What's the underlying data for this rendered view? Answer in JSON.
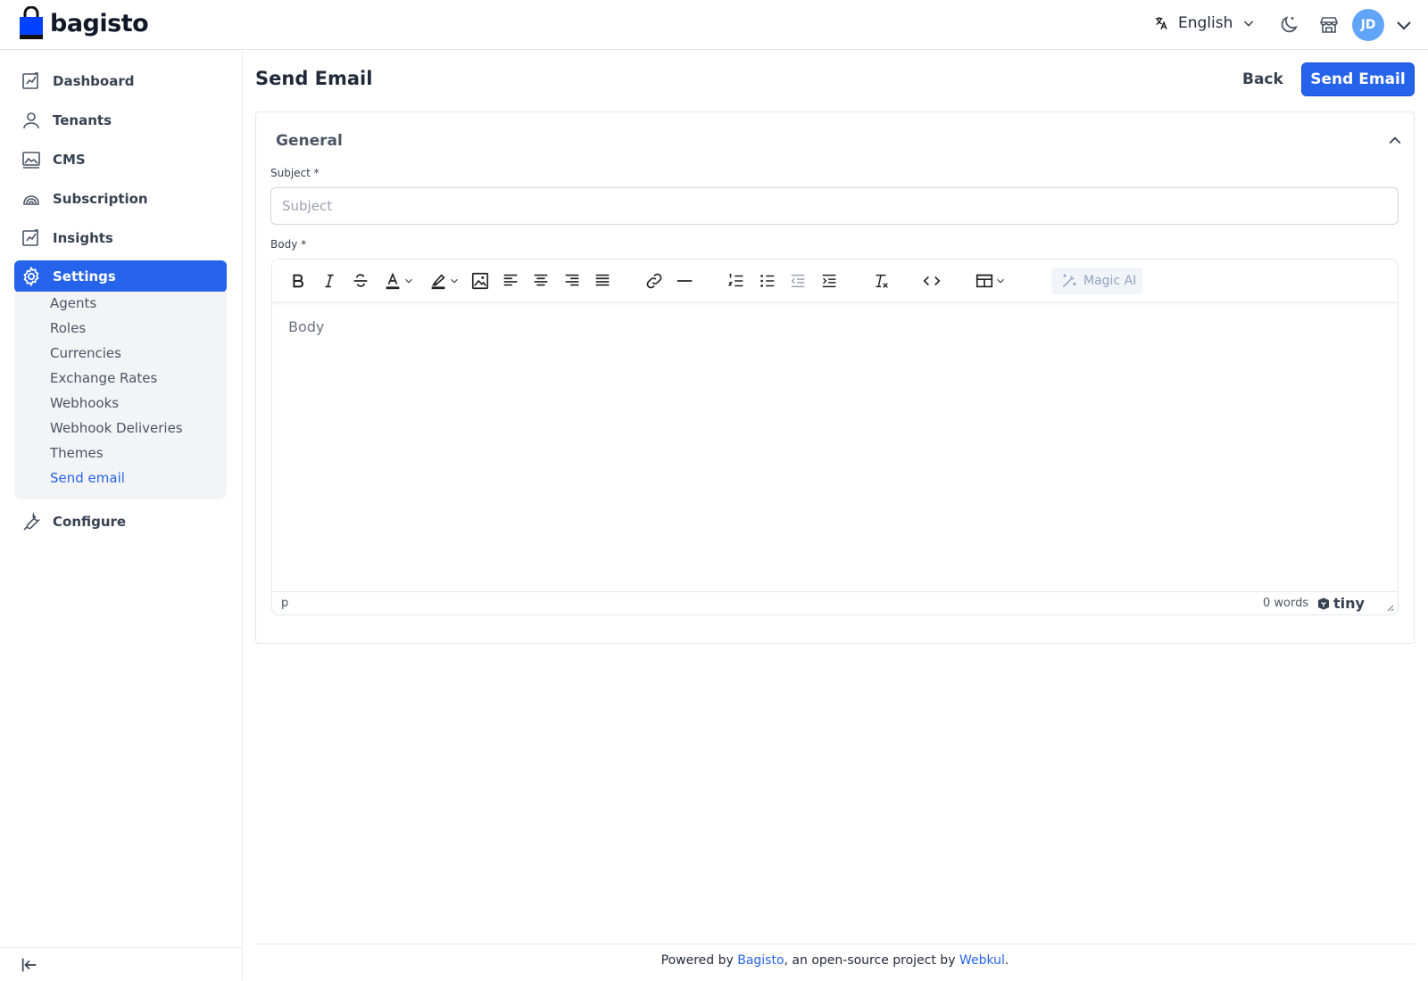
{
  "brand": {
    "name": "bagisto",
    "accent": "#2563eb"
  },
  "header": {
    "language": "English",
    "avatar_initials": "JD"
  },
  "sidebar": {
    "items": [
      {
        "label": "Dashboard"
      },
      {
        "label": "Tenants"
      },
      {
        "label": "CMS"
      },
      {
        "label": "Subscription"
      },
      {
        "label": "Insights"
      },
      {
        "label": "Settings"
      },
      {
        "label": "Configure"
      }
    ],
    "settings_sub": [
      "Agents",
      "Roles",
      "Currencies",
      "Exchange Rates",
      "Webhooks",
      "Webhook Deliveries",
      "Themes",
      "Send email"
    ]
  },
  "page": {
    "title": "Send Email",
    "back_label": "Back",
    "submit_label": "Send Email"
  },
  "form": {
    "section_title": "General",
    "subject_label": "Subject *",
    "subject_placeholder": "Subject",
    "body_label": "Body *",
    "body_placeholder": "Body"
  },
  "editor": {
    "magic_ai_label": "Magic AI",
    "path": "p",
    "word_count": "0 words",
    "brand": "tiny"
  },
  "footer": {
    "prefix": "Powered by ",
    "link1": "Bagisto",
    "middle": ", an open-source project by ",
    "link2": "Webkul",
    "suffix": "."
  }
}
